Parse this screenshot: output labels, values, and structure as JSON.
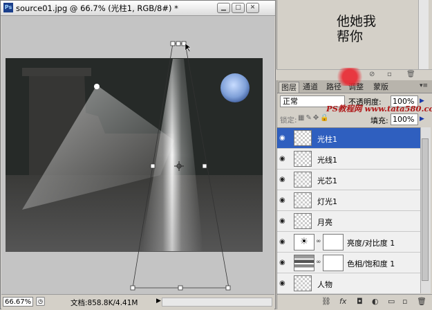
{
  "document": {
    "app_icon": "Ps",
    "title": "source01.jpg @ 66.7% (光柱1, RGB/8#) *",
    "window_buttons": [
      "minimize-icon",
      "maximize-icon",
      "close-icon"
    ],
    "zoom": "66.67%",
    "info": "文档:858.8K/4.41M"
  },
  "layers_panel": {
    "tabs": [
      "图层",
      "通道",
      "路径",
      "调整",
      "蒙版"
    ],
    "active_tab": "图层",
    "blend_mode": "正常",
    "opacity_label": "不透明度:",
    "opacity": "100%",
    "lock_label": "锁定:",
    "fill_label": "填充:",
    "fill": "100%",
    "layers": [
      {
        "name": "光柱1",
        "selected": true,
        "type": "pixel"
      },
      {
        "name": "光线1",
        "selected": false,
        "type": "pixel"
      },
      {
        "name": "光芯1",
        "selected": false,
        "type": "pixel"
      },
      {
        "name": "灯光1",
        "selected": false,
        "type": "pixel"
      },
      {
        "name": "月亮",
        "selected": false,
        "type": "pixel"
      },
      {
        "name": "亮度/对比度 1",
        "selected": false,
        "type": "adjustment"
      },
      {
        "name": "色相/饱和度 1",
        "selected": false,
        "type": "adjustment"
      },
      {
        "name": "人物",
        "selected": false,
        "type": "pixel"
      }
    ],
    "footer_icons": [
      "link-icon",
      "fx-icon",
      "mask-icon",
      "adjustment-icon",
      "folder-icon",
      "new-layer-icon",
      "trash-icon"
    ]
  },
  "watermark": {
    "calligraphy": "他她我帮你",
    "site": "PS教程网 www.tata580.com"
  },
  "colors": {
    "selected_layer": "#2f5fbf",
    "canvas_bg": "#2a2d2b",
    "seal_red": "#e81e28"
  }
}
